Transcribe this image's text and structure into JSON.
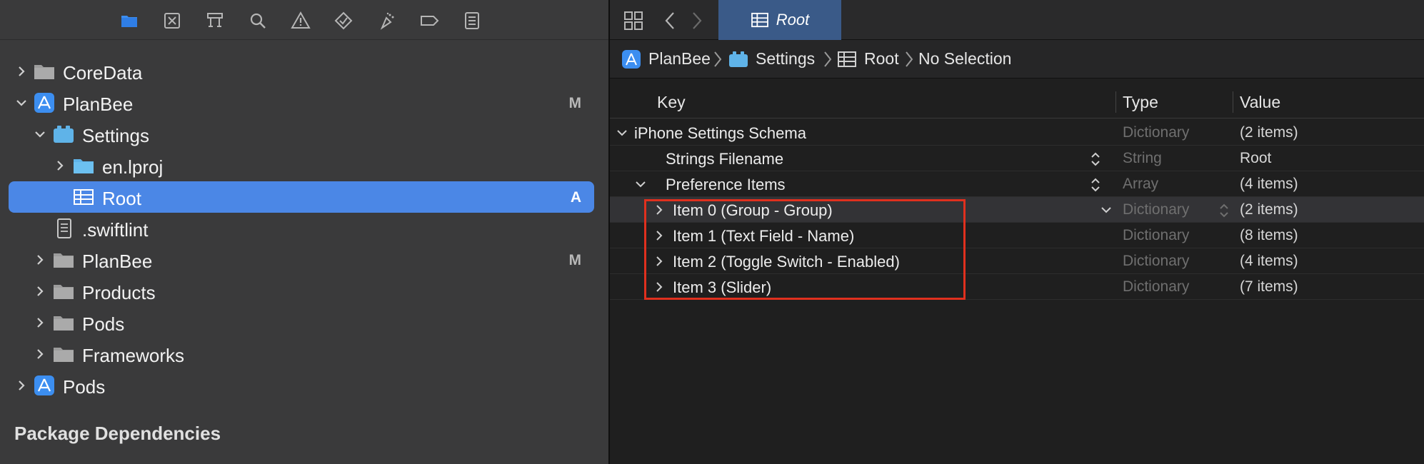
{
  "navigator": {
    "toolbar_icons": [
      "folder-icon",
      "source-control-icon",
      "hierarchy-icon",
      "search-icon",
      "warning-icon",
      "test-icon",
      "debug-icon",
      "breakpoint-icon",
      "report-icon"
    ],
    "tree": [
      {
        "label": "CoreData",
        "icon": "folder-gray-icon",
        "expanded": false,
        "badge": ""
      },
      {
        "label": "PlanBee",
        "icon": "app-project-icon",
        "expanded": true,
        "badge": "M"
      },
      {
        "label": "Settings",
        "icon": "settings-bundle-icon",
        "expanded": true,
        "badge": ""
      },
      {
        "label": "en.lproj",
        "icon": "folder-blue-icon",
        "expanded": false,
        "badge": ""
      },
      {
        "label": "Root",
        "icon": "plist-table-icon",
        "expanded": null,
        "badge": "A",
        "selected": true
      },
      {
        "label": ".swiftlint",
        "icon": "file-icon",
        "expanded": null,
        "badge": ""
      },
      {
        "label": "PlanBee",
        "icon": "folder-gray-icon",
        "expanded": false,
        "badge": "M"
      },
      {
        "label": "Products",
        "icon": "folder-gray-icon",
        "expanded": false,
        "badge": ""
      },
      {
        "label": "Pods",
        "icon": "folder-gray-icon",
        "expanded": false,
        "badge": ""
      },
      {
        "label": "Frameworks",
        "icon": "folder-gray-icon",
        "expanded": false,
        "badge": ""
      },
      {
        "label": "Pods",
        "icon": "app-project-icon",
        "expanded": false,
        "badge": ""
      }
    ],
    "section_header": "Package Dependencies"
  },
  "editor": {
    "tab": {
      "label": "Root"
    },
    "breadcrumb": [
      "PlanBee",
      "Settings",
      "Root",
      "No Selection"
    ],
    "columns": {
      "key": "Key",
      "type": "Type",
      "value": "Value"
    },
    "rows": [
      {
        "key": "iPhone Settings Schema",
        "type": "Dictionary",
        "value": "(2 items)"
      },
      {
        "key": "Strings Filename",
        "type": "String",
        "value": "Root"
      },
      {
        "key": "Preference Items",
        "type": "Array",
        "value": "(4 items)"
      },
      {
        "key": "Item 0 (Group - Group)",
        "type": "Dictionary",
        "value": "(2 items)"
      },
      {
        "key": "Item 1 (Text Field - Name)",
        "type": "Dictionary",
        "value": "(8 items)"
      },
      {
        "key": "Item 2 (Toggle Switch - Enabled)",
        "type": "Dictionary",
        "value": "(4 items)"
      },
      {
        "key": "Item 3 (Slider)",
        "type": "Dictionary",
        "value": "(7 items)"
      }
    ]
  },
  "colors": {
    "selection": "#4b87e6",
    "tab_active": "#3a5a88",
    "annotation_red": "#e0301e",
    "project_blue": "#3c8ef0"
  }
}
